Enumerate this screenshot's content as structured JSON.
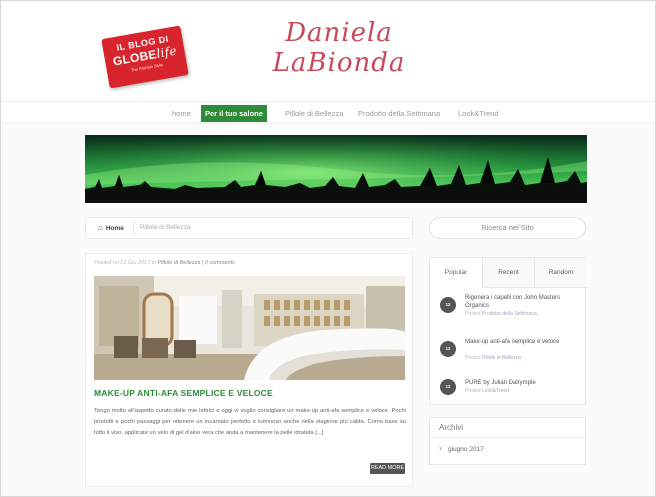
{
  "header": {
    "badge": {
      "line1": "IL BLOG DI",
      "line2a": "GLOBE",
      "line2b": "life",
      "line3": "The Fashion Style"
    },
    "site_title_line1": "Daniela",
    "site_title_line2": "LaBionda"
  },
  "nav": {
    "items": [
      {
        "label": "home",
        "active": false
      },
      {
        "label": "Per il tuo salone",
        "active": true
      },
      {
        "label": "Pillole di Bellezza",
        "active": false
      },
      {
        "label": "Prodotto della Settimana",
        "active": false
      },
      {
        "label": "Look&Trend",
        "active": false
      }
    ],
    "active_color": "#2e8b3a"
  },
  "breadcrumb": {
    "home": "Home",
    "current": "Pillole di Bellezza"
  },
  "search": {
    "label": "Ricerca nel Sito"
  },
  "post": {
    "meta_prefix": "Posted on 12 Giu 2017 in ",
    "meta_category": "Pillole di Bellezza",
    "meta_comments": " | 0 comments",
    "title": "MAKE-UP ANTI-AFA SEMPLICE E VELOCE",
    "excerpt": "Tengo molto all'aspetto curato delle mie lettrici e oggi vi voglio consigliare un make-up anti-afa semplice e veloce. Pochi prodotti e pochi passaggi per ottenere un incarnato perfetto e luminoso anche nella stagione più calda. Come base su tutto il viso, applicate un velo di gel d'aloe vera che aiuta a mantenere la pelle idratata [...]",
    "read_more": "READ MORE"
  },
  "sidebar": {
    "tabs": [
      "Popular",
      "Recent",
      "Random"
    ],
    "active_tab": "Popular",
    "items": [
      {
        "date": "12",
        "title": "Rigenera i capelli con John Masters Organics",
        "posted_prefix": "Posted ",
        "category": "Prodotto della Settimana"
      },
      {
        "date": "12",
        "title": "Make-up anti-afa semplice e veloce",
        "posted_prefix": "Posted ",
        "category": "Pillole di Bellezza"
      },
      {
        "date": "12",
        "title": "PURE by Julian Dalrymple",
        "posted_prefix": "Posted ",
        "category": "Look&Trend"
      }
    ],
    "archive": {
      "title": "Archivi",
      "items": [
        "giugno 2017"
      ]
    }
  }
}
